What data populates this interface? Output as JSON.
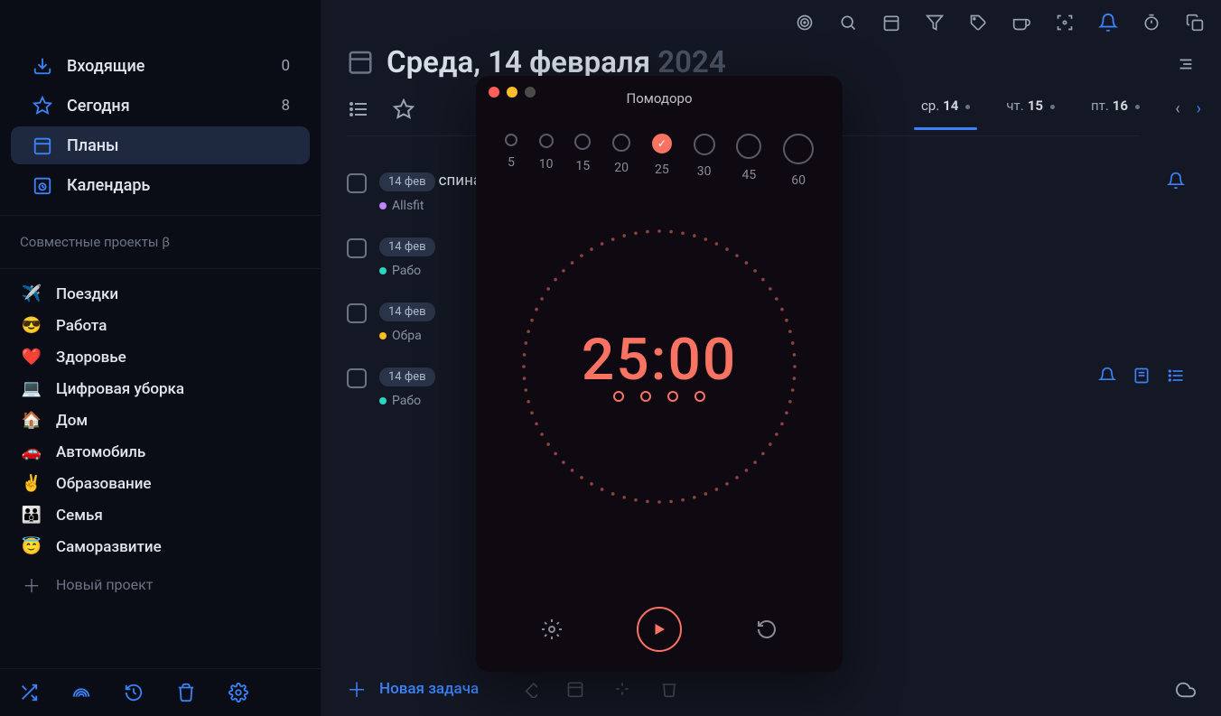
{
  "sidebar": {
    "inbox": {
      "label": "Входящие",
      "count": "0"
    },
    "today": {
      "label": "Сегодня",
      "count": "8"
    },
    "plans": {
      "label": "Планы"
    },
    "calendar": {
      "label": "Календарь"
    },
    "shared_section": "Совместные проекты β",
    "projects": [
      {
        "emoji": "✈️",
        "label": "Поездки"
      },
      {
        "emoji": "😎",
        "label": "Работа"
      },
      {
        "emoji": "❤️",
        "label": "Здоровье"
      },
      {
        "emoji": "💻",
        "label": "Цифровая уборка"
      },
      {
        "emoji": "🏠",
        "label": "Дом"
      },
      {
        "emoji": "🚗",
        "label": "Автомобиль"
      },
      {
        "emoji": "✌️",
        "label": "Образование"
      },
      {
        "emoji": "👪",
        "label": "Семья"
      },
      {
        "emoji": "😇",
        "label": "Саморазвитие"
      }
    ],
    "new_project": "Новый проект"
  },
  "header": {
    "title_weekday_day": "Среда, 14 февраля",
    "title_year": " 2024"
  },
  "daytabs": [
    {
      "short": "ср.",
      "num": "14",
      "active": true,
      "dot": true
    },
    {
      "short": "чт.",
      "num": "15",
      "active": false,
      "dot": true
    },
    {
      "short": "пт.",
      "num": "16",
      "active": false,
      "dot": true
    }
  ],
  "tasks": [
    {
      "chip": "14 фев",
      "title": "спина, мышцы кора",
      "proj": "Allsfit",
      "proj_color": "#c084fc"
    },
    {
      "chip": "14 фев",
      "title": "",
      "proj": "Рабо",
      "proj_color": "#2dd4bf"
    },
    {
      "chip": "14 фев",
      "title": "",
      "proj": "Обра",
      "proj_color": "#fbbf24"
    },
    {
      "chip": "14 фев",
      "title": "",
      "proj": "Рабо",
      "proj_color": "#2dd4bf"
    }
  ],
  "bottom": {
    "new_task": "Новая задача"
  },
  "pomodoro": {
    "title": "Помодоро",
    "presets": [
      {
        "label": "5",
        "size": 14
      },
      {
        "label": "10",
        "size": 16
      },
      {
        "label": "15",
        "size": 18
      },
      {
        "label": "20",
        "size": 20
      },
      {
        "label": "25",
        "size": 22,
        "selected": true
      },
      {
        "label": "30",
        "size": 24
      },
      {
        "label": "45",
        "size": 28
      },
      {
        "label": "60",
        "size": 34
      }
    ],
    "time": "25:00",
    "session_dots": 4
  }
}
